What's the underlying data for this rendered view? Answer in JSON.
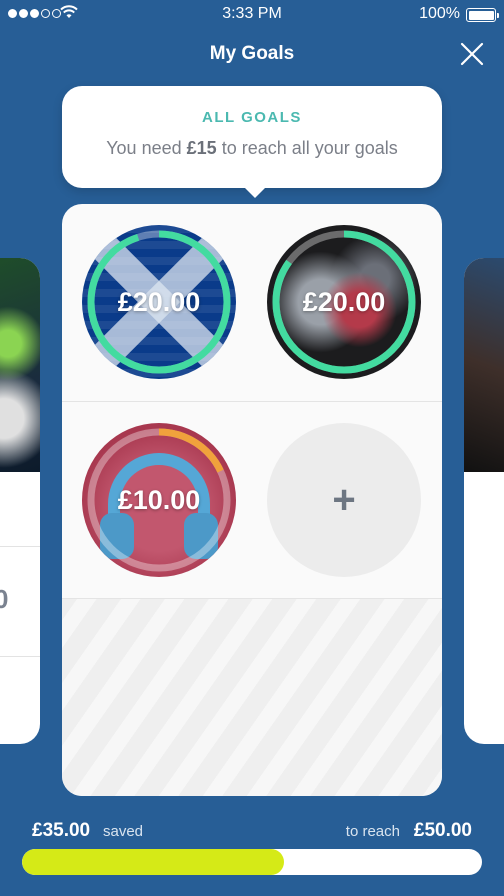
{
  "status_bar": {
    "time": "3:33 PM",
    "battery": "100%",
    "signal_bars_filled": 3,
    "signal_bars_total": 5
  },
  "header": {
    "title": "My Goals",
    "close_icon": "close-icon"
  },
  "tooltip": {
    "title": "ALL GOALS",
    "message_prefix": "You need",
    "message_amount": "£15",
    "message_suffix": "to reach all your goals"
  },
  "goals": [
    {
      "amount": "£20.00",
      "image": "scotland-flag",
      "progress": 0.95,
      "ring_color": "#43dba0"
    },
    {
      "amount": "£20.00",
      "image": "sneakers",
      "progress": 0.85,
      "ring_color": "#43dba0"
    },
    {
      "amount": "£10.00",
      "image": "headphones",
      "progress": 0.18,
      "ring_color": "#f0a23c"
    }
  ],
  "add_goal": {
    "icon": "plus-icon",
    "label": "+"
  },
  "side_card": {
    "partial_text": "0"
  },
  "footer": {
    "saved_amount": "£35.00",
    "saved_label": "saved",
    "target_label": "to reach",
    "target_amount": "£50.00",
    "progress": 0.57,
    "progress_color": "#d5ea17"
  }
}
